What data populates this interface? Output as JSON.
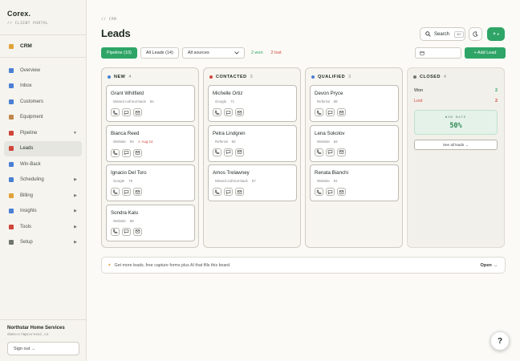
{
  "brand": {
    "name": "Corex.",
    "subtitle": "// CLIENT PORTAL"
  },
  "sidebar": {
    "section": "CRM",
    "items": [
      {
        "label": "Overview",
        "icon": "bar-chart-icon",
        "color": "#4a7fd4",
        "chevron": ""
      },
      {
        "label": "Inbox",
        "icon": "inbox-icon",
        "color": "#4a7fd4",
        "chevron": ""
      },
      {
        "label": "Customers",
        "icon": "users-icon",
        "color": "#4a7fd4",
        "chevron": ""
      },
      {
        "label": "Equipment",
        "icon": "wrench-icon",
        "color": "#c0874a",
        "chevron": ""
      },
      {
        "label": "Pipeline",
        "icon": "target-icon",
        "color": "#d0453b",
        "chevron": "▼"
      },
      {
        "label": "Leads",
        "icon": "target-icon",
        "color": "#d0453b",
        "chevron": ""
      },
      {
        "label": "Win-Back",
        "icon": "refresh-icon",
        "color": "#4a7fd4",
        "chevron": ""
      },
      {
        "label": "Scheduling",
        "icon": "calendar-icon",
        "color": "#4a7fd4",
        "chevron": "▶"
      },
      {
        "label": "Billing",
        "icon": "money-icon",
        "color": "#e0a33a",
        "chevron": "▶"
      },
      {
        "label": "Insights",
        "icon": "chart-icon",
        "color": "#4a7fd4",
        "chevron": "▶"
      },
      {
        "label": "Tools",
        "icon": "toolbox-icon",
        "color": "#d0453b",
        "chevron": "▶"
      },
      {
        "label": "Setup",
        "icon": "gear-icon",
        "color": "#6f756f",
        "chevron": "▶"
      }
    ],
    "footer": {
      "org": "Northstar Home Services",
      "email": "demo+crm@corexai.co",
      "signout": "Sign out →"
    }
  },
  "header": {
    "crumb": "// CRM",
    "title": "Leads",
    "search_label": "Search",
    "search_kbd": "⌘K",
    "add_label": "+",
    "add_chev": "▾"
  },
  "filters": {
    "pipeline": "Pipeline (10)",
    "all_leads": "All Leads (14)",
    "sources": "All sources",
    "won": "2 won",
    "lost": "2 lost",
    "add_lead": "+ Add Lead"
  },
  "columns": [
    {
      "title": "NEW",
      "count": "4",
      "dot": "#4a7fd4",
      "cards": [
        {
          "name": "Grant Whitfield",
          "source": "Missed call text-back",
          "score": "84",
          "overdue": ""
        },
        {
          "name": "Bianca Reed",
          "source": "Website",
          "score": "93",
          "overdue": "⚠ Aug 14"
        },
        {
          "name": "Ignacio Del Toro",
          "source": "Google",
          "score": "75",
          "overdue": ""
        },
        {
          "name": "Sondra Kalu",
          "source": "Website",
          "score": "98",
          "overdue": ""
        }
      ]
    },
    {
      "title": "CONTACTED",
      "count": "3",
      "dot": "#d0453b",
      "cards": [
        {
          "name": "Michelle Ortiz",
          "source": "Google",
          "score": "71",
          "overdue": ""
        },
        {
          "name": "Petra Lindgren",
          "source": "Referral",
          "score": "82",
          "overdue": ""
        },
        {
          "name": "Amos Trelawney",
          "source": "Missed call text-back",
          "score": "67",
          "overdue": ""
        }
      ]
    },
    {
      "title": "QUALIFIED",
      "count": "3",
      "dot": "#4a7fd4",
      "cards": [
        {
          "name": "Devon Pryce",
          "source": "Referral",
          "score": "88",
          "overdue": ""
        },
        {
          "name": "Lena Sokolov",
          "source": "Website",
          "score": "84",
          "overdue": ""
        },
        {
          "name": "Renata Bianchi",
          "source": "Website",
          "score": "91",
          "overdue": ""
        }
      ]
    }
  ],
  "closed": {
    "title": "CLOSED",
    "count": "4",
    "dot": "#6f756f",
    "won_label": "Won",
    "won_count": "2",
    "lost_label": "Lost",
    "lost_count": "2",
    "winrate_label": "WIN RATE",
    "winrate_value": "50%",
    "see_all": "See all leads →"
  },
  "banner": {
    "spark": "✦",
    "text": "Get more leads, free capture forms plus AI that fills this board.",
    "open": "Open →"
  },
  "help": "?"
}
